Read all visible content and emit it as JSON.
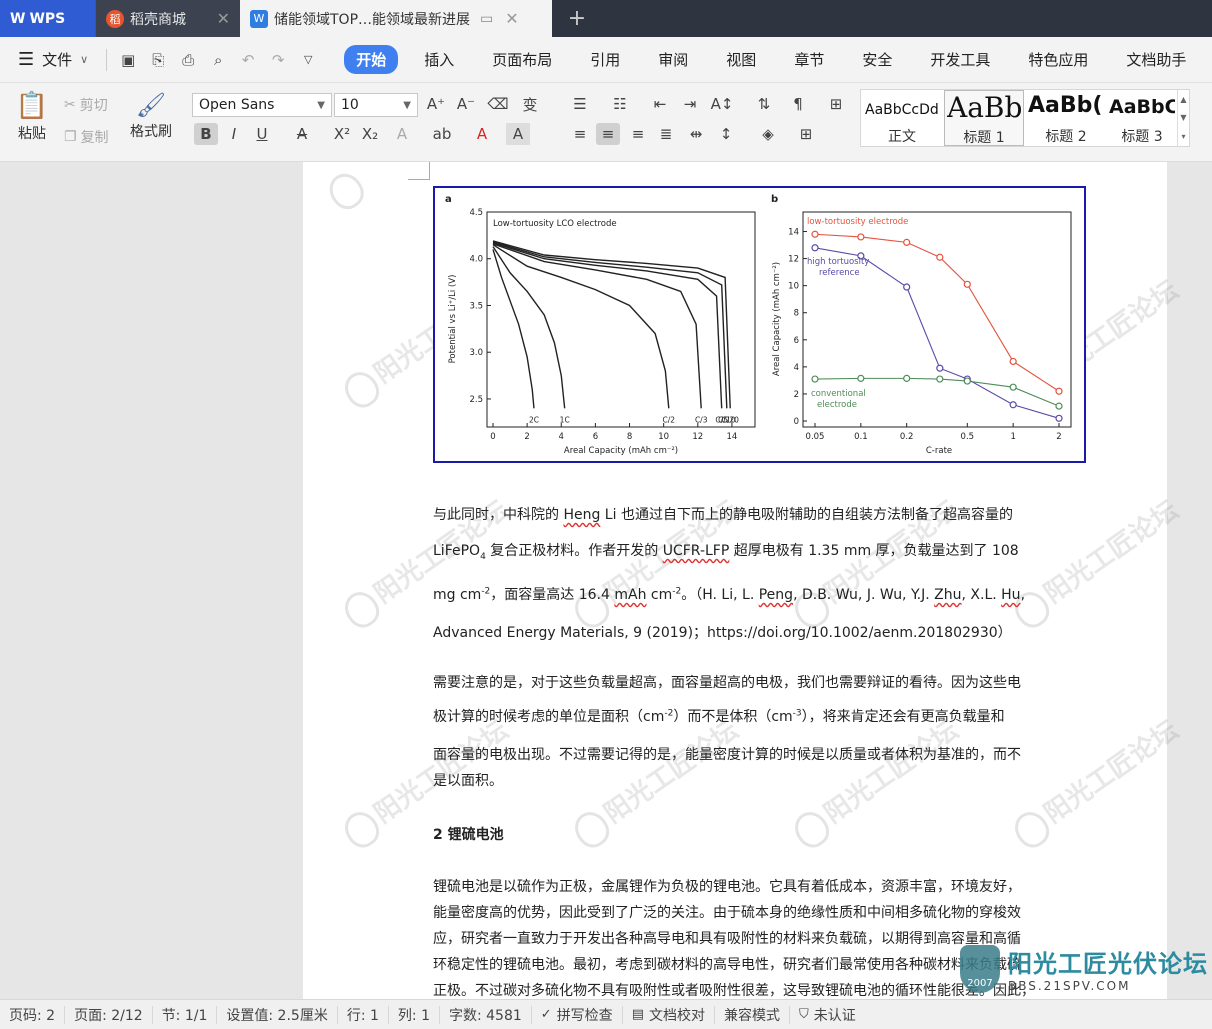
{
  "tabs": {
    "wps": "WPS",
    "store": "稻壳商城",
    "doc": "储能领域TOP…能领域最新进展"
  },
  "menu": {
    "file": "文件",
    "items": [
      "开始",
      "插入",
      "页面布局",
      "引用",
      "审阅",
      "视图",
      "章节",
      "安全",
      "开发工具",
      "特色应用",
      "文档助手"
    ]
  },
  "ribbon": {
    "paste": "粘贴",
    "cut": "剪切",
    "copy": "复制",
    "format_painter": "格式刷",
    "font_name": "Open Sans",
    "font_size": "10",
    "styles": [
      {
        "sample": "AaBbCcDd",
        "name": "正文"
      },
      {
        "sample": "AaBb",
        "name": "标题 1"
      },
      {
        "sample": "AaBb(",
        "name": "标题 2"
      },
      {
        "sample": "AaBbC",
        "name": "标题 3"
      }
    ]
  },
  "figure": {
    "a": {
      "panel": "a",
      "title": "Low-tortuosity LCO electrode",
      "xlabel": "Areal Capacity (mAh cm⁻²)",
      "ylabel": "Potential vs Li⁺/Li (V)",
      "xticks": [
        "0",
        "2",
        "4",
        "6",
        "8",
        "10",
        "12",
        "14"
      ],
      "yticks": [
        "4.5",
        "4.0",
        "3.5",
        "3.0",
        "2.5"
      ],
      "rates": [
        "2C",
        "1C",
        "C/2",
        "C/3",
        "C/5",
        "C/10",
        "C/20"
      ]
    },
    "b": {
      "panel": "b",
      "xlabel": "C-rate",
      "ylabel": "Areal Capacity (mAh cm⁻²)",
      "xticks": [
        "0.05",
        "0.1",
        "0.2",
        "0.5",
        "1",
        "2"
      ],
      "yticks": [
        "0",
        "2",
        "4",
        "6",
        "8",
        "10",
        "12",
        "14"
      ],
      "legend_low": "low-tortuosity electrode",
      "legend_high_1": "high tortuosity",
      "legend_high_2": "reference",
      "legend_conv_1": "conventional",
      "legend_conv_2": "electrode"
    }
  },
  "chart_data": [
    {
      "type": "line",
      "title": "Low-tortuosity LCO electrode",
      "xlabel": "Areal Capacity (mAh cm⁻²)",
      "ylabel": "Potential vs Li⁺/Li (V)",
      "xlim": [
        0,
        15
      ],
      "ylim": [
        2.2,
        4.5
      ],
      "series": [
        {
          "name": "2C",
          "x": [
            0,
            0.5,
            1,
            1.5,
            2,
            2.3,
            2.4
          ],
          "y": [
            4.1,
            3.8,
            3.55,
            3.3,
            2.95,
            2.6,
            2.4
          ]
        },
        {
          "name": "1C",
          "x": [
            0,
            1,
            2,
            3,
            3.6,
            4.0,
            4.2
          ],
          "y": [
            4.13,
            3.85,
            3.65,
            3.4,
            3.1,
            2.75,
            2.4
          ]
        },
        {
          "name": "C/2",
          "x": [
            0,
            2,
            4,
            6,
            8,
            9.5,
            10.1,
            10.3
          ],
          "y": [
            4.15,
            3.92,
            3.8,
            3.67,
            3.5,
            3.2,
            2.8,
            2.4
          ]
        },
        {
          "name": "C/3",
          "x": [
            0,
            3,
            6,
            9,
            11,
            11.9,
            12.2
          ],
          "y": [
            4.16,
            3.97,
            3.88,
            3.78,
            3.65,
            3.3,
            2.4
          ]
        },
        {
          "name": "C/5",
          "x": [
            0,
            3,
            6,
            9,
            12,
            13.1,
            13.4
          ],
          "y": [
            4.17,
            4.0,
            3.93,
            3.87,
            3.78,
            3.6,
            2.4
          ]
        },
        {
          "name": "C/10",
          "x": [
            0,
            3,
            6,
            9,
            12,
            13.4,
            13.7
          ],
          "y": [
            4.18,
            4.02,
            3.96,
            3.91,
            3.85,
            3.72,
            2.4
          ]
        },
        {
          "name": "C/20",
          "x": [
            0,
            3,
            6,
            9,
            12,
            13.6,
            13.9
          ],
          "y": [
            4.19,
            4.04,
            3.99,
            3.95,
            3.9,
            3.8,
            2.4
          ]
        }
      ]
    },
    {
      "type": "line",
      "xlabel": "C-rate",
      "ylabel": "Areal Capacity (mAh cm⁻²)",
      "ylim": [
        0,
        15
      ],
      "x_scale": "log",
      "series": [
        {
          "name": "low-tortuosity electrode",
          "color": "#e4533f",
          "x": [
            0.05,
            0.1,
            0.2,
            0.33,
            0.5,
            1,
            2
          ],
          "y": [
            13.8,
            13.6,
            13.2,
            12.1,
            10.1,
            4.4,
            2.2
          ]
        },
        {
          "name": "high tortuosity reference",
          "color": "#5b4aa8",
          "x": [
            0.05,
            0.1,
            0.2,
            0.33,
            0.5,
            1,
            2
          ],
          "y": [
            12.8,
            12.2,
            9.9,
            3.9,
            3.1,
            1.2,
            0.2
          ]
        },
        {
          "name": "conventional electrode",
          "color": "#4f8c59",
          "x": [
            0.05,
            0.1,
            0.2,
            0.33,
            0.5,
            1,
            2
          ],
          "y": [
            3.1,
            3.15,
            3.15,
            3.1,
            2.95,
            2.5,
            1.1
          ]
        }
      ]
    }
  ],
  "body": {
    "p1_l1a": "与此同时，中科院的 ",
    "p1_l1b": "Heng",
    "p1_l1c": " Li 也通过自下而上的静电吸附辅助的自组装方法制备了超高容量的",
    "p1_l2a": "LiFePO",
    "p1_l2sub": "4",
    "p1_l2b": " 复合正极材料。作者开发的 ",
    "p1_l2c": "UCFR-LFP",
    "p1_l2d": " 超厚电极有 1.35 mm 厚，负载量达到了 108",
    "p1_l3a": "mg cm",
    "p1_l3sup1": "-2",
    "p1_l3b": "，面容量高达 16.4 ",
    "p1_l3c": "mAh",
    "p1_l3d": " cm",
    "p1_l3sup2": "-2",
    "p1_l3e": "。（H. Li, L. ",
    "p1_l3f": "Peng",
    "p1_l3g": ", D.B. Wu, J. Wu, Y.J. ",
    "p1_l3h": "Zhu",
    "p1_l3i": ", X.L. ",
    "p1_l3j": "Hu",
    "p1_l3k": ",",
    "p1_l4a": "Advanced Energy Materials, 9 (2019)；",
    "p1_l4b": "https://doi.org/10.1002/aenm.201802930",
    "p1_l4c": "）",
    "p2_l1": "需要注意的是，对于这些负载量超高，面容量超高的电极，我们也需要辩证的看待。因为这些电",
    "p2_l2a": "极计算的时候考虑的单位是面积（cm",
    "p2_l2sup1": "-2",
    "p2_l2b": "）而不是体积（cm",
    "p2_l2sup2": "-3",
    "p2_l2c": "），将来肯定还会有更高负载量和",
    "p2_l3": "面容量的电极出现。不过需要记得的是，能量密度计算的时候是以质量或者体积为基准的，而不",
    "p2_l4": "是以面积。",
    "heading2": "2 锂硫电池",
    "p3_l1": "锂硫电池是以硫作为正极，金属锂作为负极的锂电池。它具有着低成本，资源丰富，环境友好，",
    "p3_l2": "能量密度高的优势，因此受到了广泛的关注。由于硫本身的绝缘性质和中间相多硫化物的穿梭效",
    "p3_l3": "应，研究者一直致力于开发出各种高导电和具有吸附性的材料来负载硫，以期得到高容量和高循",
    "p3_l4": "环稳定性的锂硫电池。最初，考虑到碳材料的高导电性，研究者们最常使用各种碳材料来负载硫",
    "p3_l5": "正极。不过碳对多硫化物不具有吸附性或者吸附性很差，这导致锂硫电池的循环性能很差。因此，"
  },
  "watermark": {
    "text": "阳光工匠论坛",
    "site": "BBS.21SPV.COM",
    "logo_title": "阳光工匠光伏论坛",
    "logo_site": "BBS.21SPV.COM",
    "logo_year": "2007"
  },
  "status": {
    "page_num": "页码: 2",
    "pages": "页面: 2/12",
    "section": "节: 1/1",
    "setting": "设置值: 2.5厘米",
    "row": "行: 1",
    "col": "列: 1",
    "words": "字数: 4581",
    "spell": "拼写检查",
    "proof": "文档校对",
    "compat": "兼容模式",
    "cert": "未认证"
  },
  "colors": {
    "accent": "#3f7ff0",
    "tab_dark": "#2e3440",
    "wps_blue": "#2f5bd3",
    "figure_border": "#1a1aa8"
  }
}
